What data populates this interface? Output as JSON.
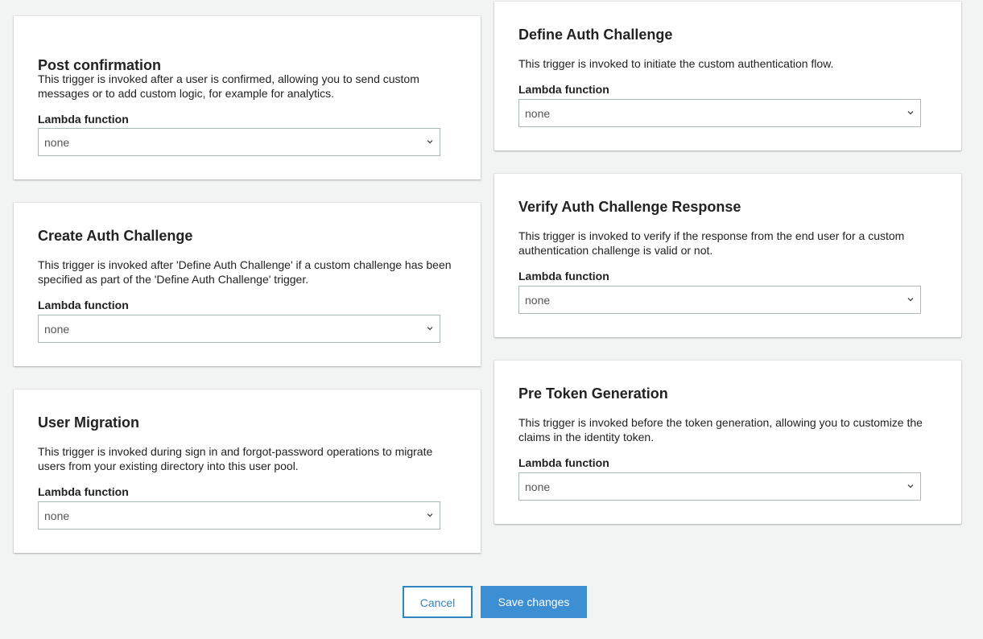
{
  "triggers": {
    "post_confirmation": {
      "title": "Post confirmation",
      "description": "This trigger is invoked after a user is confirmed, allowing you to send custom messages or to add custom logic, for example for analytics.",
      "field_label": "Lambda function",
      "selected": "none"
    },
    "create_auth_challenge": {
      "title": "Create Auth Challenge",
      "description": "This trigger is invoked after 'Define Auth Challenge' if a custom challenge has been specified as part of the 'Define Auth Challenge' trigger.",
      "field_label": "Lambda function",
      "selected": "none"
    },
    "user_migration": {
      "title": "User Migration",
      "description": "This trigger is invoked during sign in and forgot-password operations to migrate users from your existing directory into this user pool.",
      "field_label": "Lambda function",
      "selected": "none"
    },
    "define_auth_challenge": {
      "title": "Define Auth Challenge",
      "description": "This trigger is invoked to initiate the custom authentication flow.",
      "field_label": "Lambda function",
      "selected": "none"
    },
    "verify_auth_challenge_response": {
      "title": "Verify Auth Challenge Response",
      "description": "This trigger is invoked to verify if the response from the end user for a custom authentication challenge is valid or not.",
      "field_label": "Lambda function",
      "selected": "none"
    },
    "pre_token_generation": {
      "title": "Pre Token Generation",
      "description": "This trigger is invoked before the token generation, allowing you to customize the claims in the identity token.",
      "field_label": "Lambda function",
      "selected": "none"
    }
  },
  "actions": {
    "cancel_label": "Cancel",
    "save_label": "Save changes"
  },
  "colors": {
    "background": "#f2f3f3",
    "card": "#ffffff",
    "primary": "#3d8fd3",
    "link": "#3184c2",
    "select_border": "#aab7b8"
  },
  "icons": {
    "select_arrow": "chevron-down-icon"
  }
}
